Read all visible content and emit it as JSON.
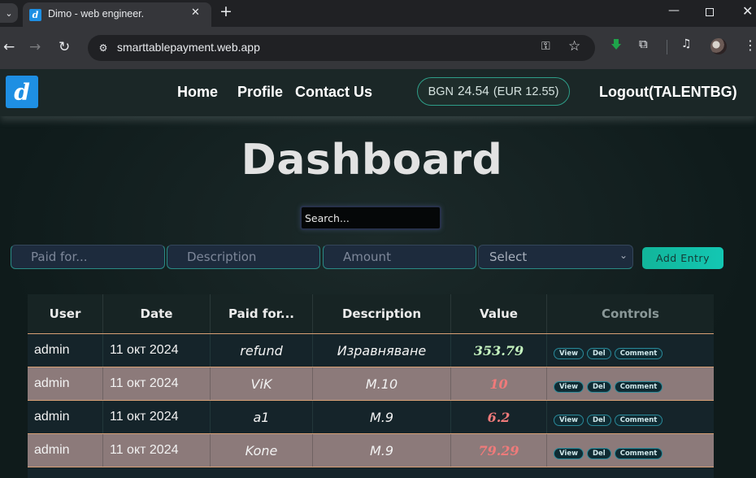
{
  "browser": {
    "tab_title": "Dimo - web engineer.",
    "favicon_letter": "d",
    "url": "smarttablepayment.web.app"
  },
  "header": {
    "logo_letter": "d",
    "nav": [
      "Home",
      "Profile",
      "Contact Us"
    ],
    "balance": {
      "bgn_label": "BGN",
      "bgn_amount": "24.54",
      "eur": "(EUR 12.55)"
    },
    "logout": "Logout(TALENTBG)"
  },
  "dashboard": {
    "title": "Dashboard",
    "search_placeholder": "Search...",
    "form": {
      "paid_for_placeholder": "Paid for...",
      "description_placeholder": "Description",
      "amount_placeholder": "Amount",
      "select_value": "Select",
      "add_button": "Add Entry"
    },
    "table": {
      "headers": [
        "User",
        "Date",
        "Paid for...",
        "Description",
        "Value",
        "Controls"
      ],
      "control_labels": {
        "view": "View",
        "del": "Del",
        "comment": "Comment"
      },
      "rows": [
        {
          "user": "admin",
          "date": "11 окт 2024",
          "paid_for": "refund",
          "description": "Изравняване",
          "value": "353.79",
          "value_color": "#c6f5c0"
        },
        {
          "user": "admin",
          "date": "11 окт 2024",
          "paid_for": "ViK",
          "description": "M.10",
          "value": "10",
          "value_color": "#f07a7a"
        },
        {
          "user": "admin",
          "date": "11 окт 2024",
          "paid_for": "a1",
          "description": "M.9",
          "value": "6.2",
          "value_color": "#f07a7a"
        },
        {
          "user": "admin",
          "date": "11 окт 2024",
          "paid_for": "Kone",
          "description": "M.9",
          "value": "79.29",
          "value_color": "#f07a7a"
        }
      ]
    }
  },
  "colors": {
    "accent": "#13c7b3",
    "brand": "#1e8fe3",
    "row_alt": "#8c7a7a",
    "row_dark": "#15242a",
    "row_border": "#d8a075"
  }
}
